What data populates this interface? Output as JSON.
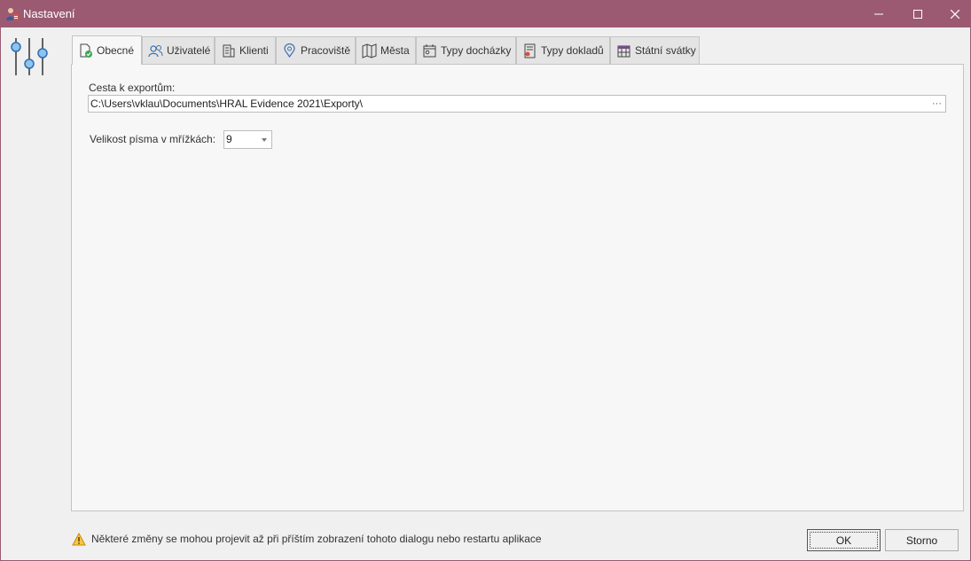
{
  "window": {
    "title": "Nastavení",
    "title_bar_color": "#9b5a72",
    "icons": [
      "app-icon",
      "minimize-icon",
      "maximize-icon",
      "close-icon"
    ]
  },
  "tabs": [
    {
      "label": "Obecné",
      "icon": "document-check-icon",
      "active": true
    },
    {
      "label": "Uživatelé",
      "icon": "users-icon",
      "active": false
    },
    {
      "label": "Klienti",
      "icon": "building-icon",
      "active": false
    },
    {
      "label": "Pracoviště",
      "icon": "location-pin-icon",
      "active": false
    },
    {
      "label": "Města",
      "icon": "map-icon",
      "active": false
    },
    {
      "label": "Typy docházky",
      "icon": "attendance-icon",
      "active": false
    },
    {
      "label": "Typy dokladů",
      "icon": "receipt-icon",
      "active": false
    },
    {
      "label": "Státní svátky",
      "icon": "calendar-icon",
      "active": false
    }
  ],
  "general": {
    "export_path_label": "Cesta k exportům:",
    "export_path_value": "C:\\Users\\vklau\\Documents\\HRAL Evidence 2021\\Exporty\\",
    "browse_label": "···",
    "font_size_label": "Velikost písma v mřížkách:",
    "font_size_value": "9"
  },
  "footer": {
    "warning_text": "Některé změny se mohou projevit až při příštím zobrazení tohoto dialogu nebo restartu aplikace",
    "ok_label": "OK",
    "cancel_label": "Storno"
  }
}
